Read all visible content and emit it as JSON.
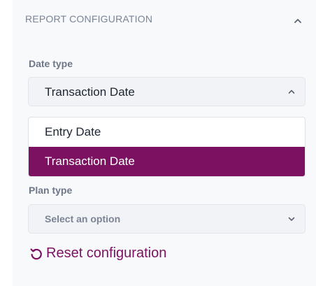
{
  "panel": {
    "title": "REPORT CONFIGURATION",
    "collapse_icon": "chevron-up-icon"
  },
  "date_type": {
    "label": "Date type",
    "selected_value": "Transaction Date",
    "chevron_icon": "chevron-up-icon",
    "options": [
      {
        "label": "Entry Date",
        "selected": false
      },
      {
        "label": "Transaction Date",
        "selected": true
      }
    ]
  },
  "plan_type": {
    "label": "Plan type",
    "placeholder": "Select an option",
    "chevron_icon": "chevron-down-icon"
  },
  "reset": {
    "label": "Reset configuration",
    "icon": "reset-icon"
  },
  "colors": {
    "accent": "#7c1162",
    "panel_bg": "#f8f9fb",
    "field_bg": "#f2f3f6",
    "muted_text": "#7a8494"
  }
}
